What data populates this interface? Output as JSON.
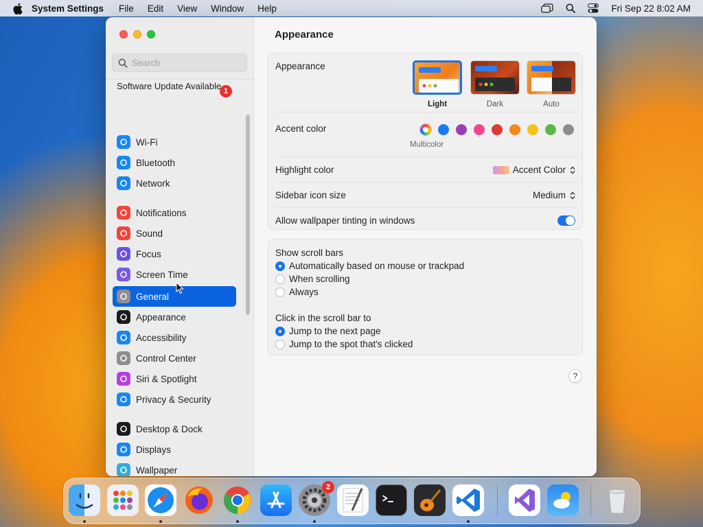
{
  "menubar": {
    "app_name": "System Settings",
    "menus": [
      "File",
      "Edit",
      "View",
      "Window",
      "Help"
    ],
    "clock": "Fri Sep 22  8:02 AM"
  },
  "sidebar": {
    "search_placeholder": "Search",
    "update_text": "Software Update Available",
    "update_badge": "1",
    "items": [
      {
        "label": "Wi-Fi",
        "icon": "wifi-icon",
        "color": "#1a86f0"
      },
      {
        "label": "Bluetooth",
        "icon": "bluetooth-icon",
        "color": "#1a86f0"
      },
      {
        "label": "Network",
        "icon": "globe-icon",
        "color": "#1a86f0"
      },
      {
        "label": "Notifications",
        "icon": "bell-icon",
        "color": "#f0453a"
      },
      {
        "label": "Sound",
        "icon": "speaker-icon",
        "color": "#f0453a"
      },
      {
        "label": "Focus",
        "icon": "moon-icon",
        "color": "#6e52d8"
      },
      {
        "label": "Screen Time",
        "icon": "hourglass-icon",
        "color": "#7a5ae0"
      },
      {
        "label": "General",
        "icon": "gear-icon",
        "color": "#8e8e93"
      },
      {
        "label": "Appearance",
        "icon": "appearance-icon",
        "color": "#1c1c1e"
      },
      {
        "label": "Accessibility",
        "icon": "accessibility-icon",
        "color": "#1a86f0"
      },
      {
        "label": "Control Center",
        "icon": "control-center-icon",
        "color": "#8e8e93"
      },
      {
        "label": "Siri & Spotlight",
        "icon": "siri-icon",
        "color": "#b53ee0"
      },
      {
        "label": "Privacy & Security",
        "icon": "hand-icon",
        "color": "#1a86f0"
      },
      {
        "label": "Desktop & Dock",
        "icon": "dock-icon",
        "color": "#1c1c1e"
      },
      {
        "label": "Displays",
        "icon": "sun-icon",
        "color": "#1a86f0"
      },
      {
        "label": "Wallpaper",
        "icon": "wallpaper-icon",
        "color": "#34aadc"
      }
    ],
    "selected_index": 7
  },
  "content": {
    "title": "Appearance",
    "appearance_label": "Appearance",
    "themes": [
      "Light",
      "Dark",
      "Auto"
    ],
    "selected_theme": "Light",
    "accent_label": "Accent color",
    "accent_selected_label": "Multicolor",
    "accent_colors": [
      "#1a7cf0",
      "#9b3fb5",
      "#f0468c",
      "#e03a34",
      "#f5881a",
      "#f6c21a",
      "#5cb842",
      "#8c8c8c"
    ],
    "highlight_label": "Highlight color",
    "highlight_value": "Accent Color",
    "sidebar_icon_label": "Sidebar icon size",
    "sidebar_icon_value": "Medium",
    "tinting_label": "Allow wallpaper tinting in windows",
    "tinting_on": true,
    "scrollbars_label": "Show scroll bars",
    "scrollbar_options": [
      "Automatically based on mouse or trackpad",
      "When scrolling",
      "Always"
    ],
    "scrollbar_selected": 0,
    "click_label": "Click in the scroll bar to",
    "click_options": [
      "Jump to the next page",
      "Jump to the spot that's clicked"
    ],
    "click_selected": 0,
    "help": "?"
  },
  "dock": {
    "apps": [
      "Finder",
      "Launchpad",
      "Safari",
      "Firefox",
      "Chrome",
      "App Store",
      "System Settings",
      "TextEdit",
      "Terminal",
      "GarageBand",
      "Visual Studio Code",
      "Visual Studio",
      "Weather",
      "Trash"
    ],
    "settings_badge": "2"
  }
}
